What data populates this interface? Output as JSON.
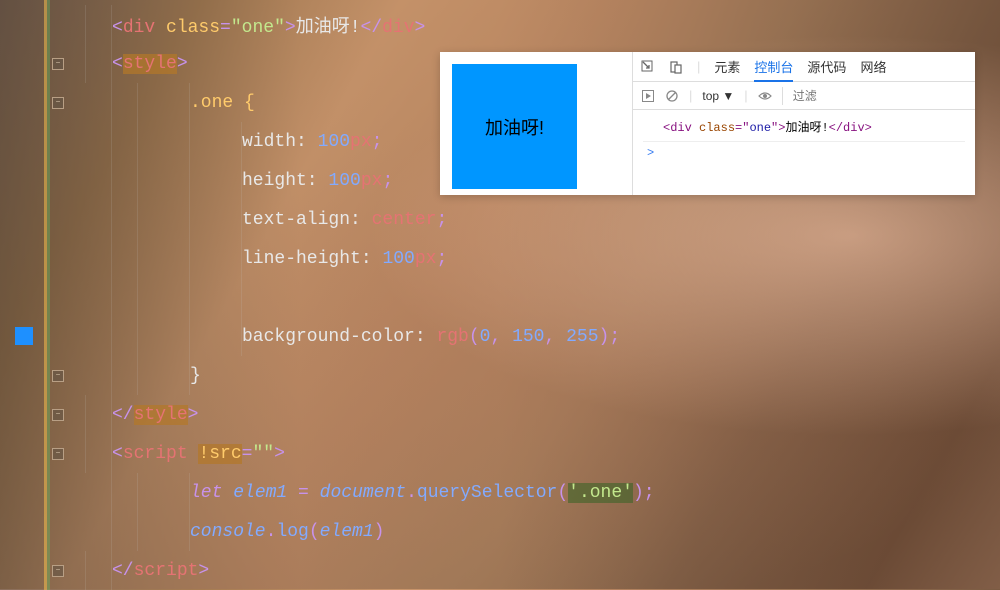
{
  "code": {
    "div_open_1": "<",
    "div_tag": "div",
    "div_sp": " ",
    "class_attr": "class",
    "eq": "=",
    "class_val_q": "\"",
    "class_val": "one",
    "div_open_2": ">",
    "div_text": "加油呀!",
    "div_close": "</",
    "style_tag": "style",
    "selector": ".one {",
    "width_prop": "width: ",
    "width_num": "100",
    "width_unit": "px",
    "height_prop": "height: ",
    "height_num": "100",
    "textalign_prop": "text-align: ",
    "textalign_val": "center",
    "lineheight_prop": "line-height: ",
    "lineheight_num": "100",
    "bgcolor_prop": "background-color: ",
    "rgb_fn": "rgb",
    "rgb_r": "0",
    "rgb_g": "150",
    "rgb_b": "255",
    "close_brace": "}",
    "script_tag": "script",
    "src_attr": "!src",
    "src_val": "",
    "let_kw": "let",
    "elem1": "elem1",
    "document": "document",
    "querySelector": "querySelector",
    "qs_arg": "'.one'",
    "console": "console",
    "log": "log",
    "semi": ";",
    "comma": ", ",
    "paren_o": "(",
    "paren_c": ")",
    "dot": "."
  },
  "preview": {
    "text": "加油呀!"
  },
  "devtools": {
    "tabs": {
      "elements": "元素",
      "console": "控制台",
      "sources": "源代码",
      "network": "网络"
    },
    "toolbar": {
      "top": "top ▼",
      "filter_placeholder": "过滤"
    },
    "log": {
      "open": "<div ",
      "class_attr": "class",
      "eq": "=\"",
      "class_val": "one",
      "q2": "\">",
      "text": "加油呀!",
      "close": "</div>"
    },
    "prompt": ">"
  }
}
